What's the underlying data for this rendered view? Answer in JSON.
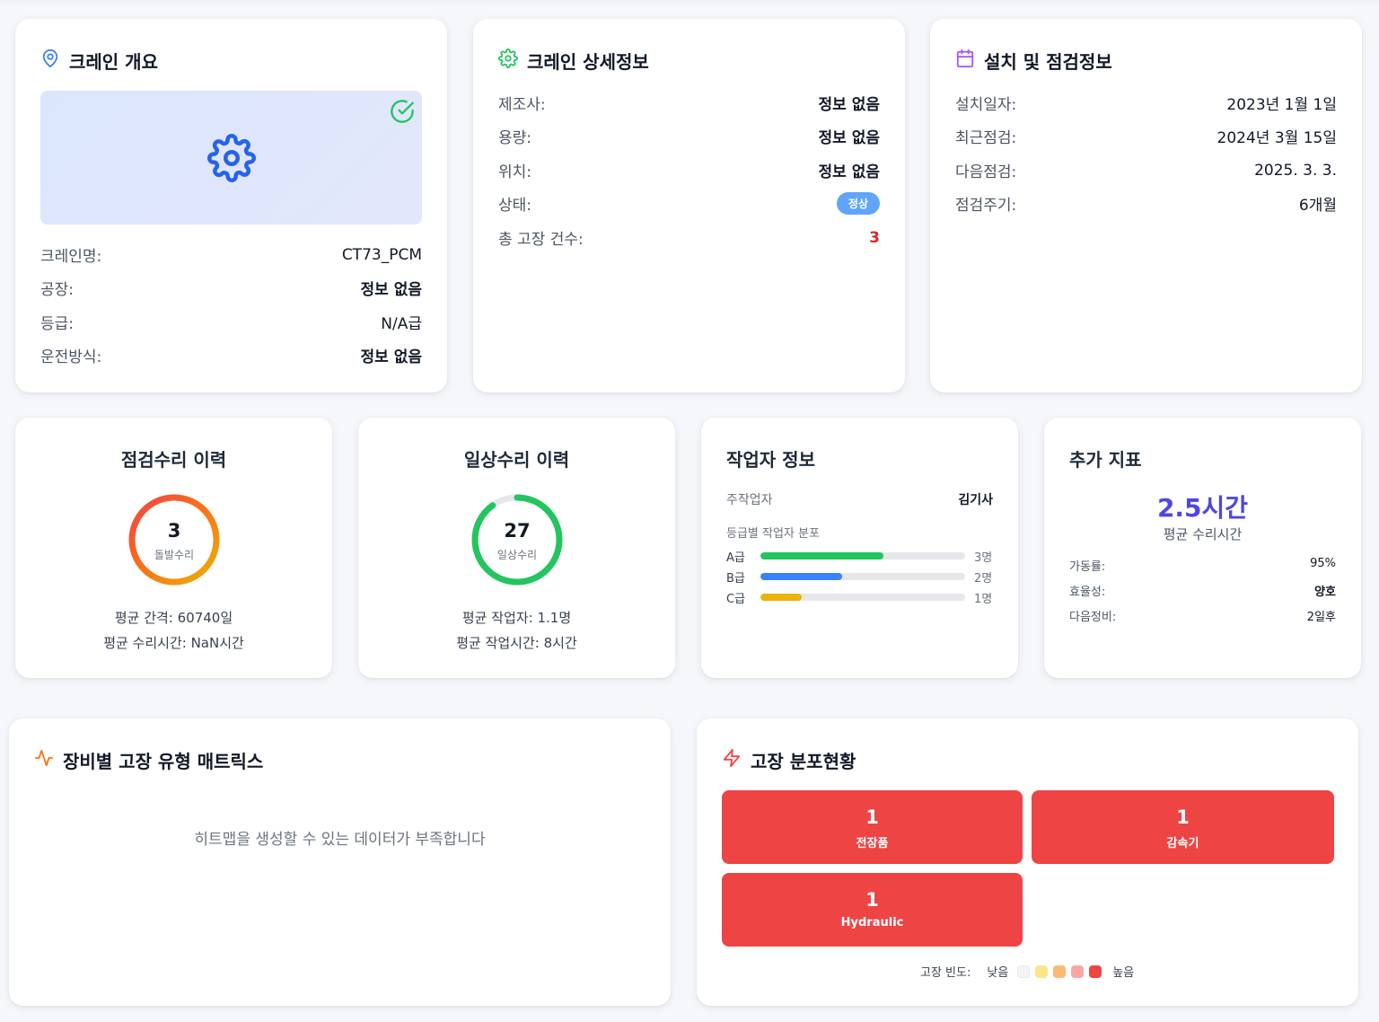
{
  "overview": {
    "title": "크레인 개요",
    "rows": [
      {
        "label": "크레인명:",
        "value": "CT73_PCM"
      },
      {
        "label": "공장:",
        "value": "정보 없음"
      },
      {
        "label": "등급:",
        "value": "N/A급"
      },
      {
        "label": "운전방식:",
        "value": "정보 없음"
      }
    ]
  },
  "detail": {
    "title": "크레인 상세정보",
    "rows": [
      {
        "label": "제조사:",
        "value": "정보 없음"
      },
      {
        "label": "용량:",
        "value": "정보 없음"
      },
      {
        "label": "위치:",
        "value": "정보 없음"
      },
      {
        "label": "상태:",
        "value": "정상"
      },
      {
        "label": "총 고장 건수:",
        "value": "3"
      }
    ]
  },
  "install": {
    "title": "설치 및 점검정보",
    "rows": [
      {
        "label": "설치일자:",
        "value": "2023년 1월 1일"
      },
      {
        "label": "최근점검:",
        "value": "2024년 3월 15일"
      },
      {
        "label": "다음점검:",
        "value": "2025. 3. 3."
      },
      {
        "label": "점검주기:",
        "value": "6개월"
      }
    ]
  },
  "inspection_history": {
    "title": "점검수리 이력",
    "count": "3",
    "count_label": "돌발수리",
    "line1": "평균 간격: 60740일",
    "line2": "평균 수리시간: NaN시간",
    "progress": 1.0
  },
  "daily_history": {
    "title": "일상수리 이력",
    "count": "27",
    "count_label": "일상수리",
    "line1": "평균 작업자: 1.1명",
    "line2": "평균 작업시간: 8시간",
    "progress": 0.9
  },
  "worker": {
    "title": "작업자 정보",
    "main_label": "주작업자",
    "main_value": "김기사",
    "dist_title": "등급별 작업자 분포",
    "grades": [
      {
        "label": "A급",
        "count": "3명",
        "fraction": 0.6,
        "color": "#22c55e"
      },
      {
        "label": "B급",
        "count": "2명",
        "fraction": 0.4,
        "color": "#3b82f6"
      },
      {
        "label": "C급",
        "count": "1명",
        "fraction": 0.2,
        "color": "#eab308"
      }
    ]
  },
  "extra": {
    "title": "추가 지표",
    "big_value": "2.5시간",
    "big_label": "평균 수리시간",
    "rows": [
      {
        "label": "가동률:",
        "value": "95%"
      },
      {
        "label": "효율성:",
        "value": "양호"
      },
      {
        "label": "다음정비:",
        "value": "2일후"
      }
    ]
  },
  "matrix": {
    "title": "장비별 고장 유형 매트릭스",
    "empty_message": "히트맵을 생성할 수 있는 데이터가 부족합니다"
  },
  "distribution": {
    "title": "고장 분포현황",
    "tiles": [
      {
        "count": "1",
        "label": "전장품"
      },
      {
        "count": "1",
        "label": "감속기"
      },
      {
        "count": "1",
        "label": "Hydraulic"
      }
    ],
    "legend_label": "고장 빈도:",
    "legend_low": "낮음",
    "legend_high": "높음",
    "legend_colors": [
      "#f3f4f6",
      "#fde68a",
      "#fdba74",
      "#fca5a5",
      "#ef4444"
    ]
  },
  "colors": {
    "accent_blue": "#3b82f6",
    "accent_green": "#22c55e",
    "accent_purple": "#a855f7",
    "accent_red": "#ef4444",
    "accent_orange": "#f97316",
    "big_value": "#4f46e5"
  }
}
